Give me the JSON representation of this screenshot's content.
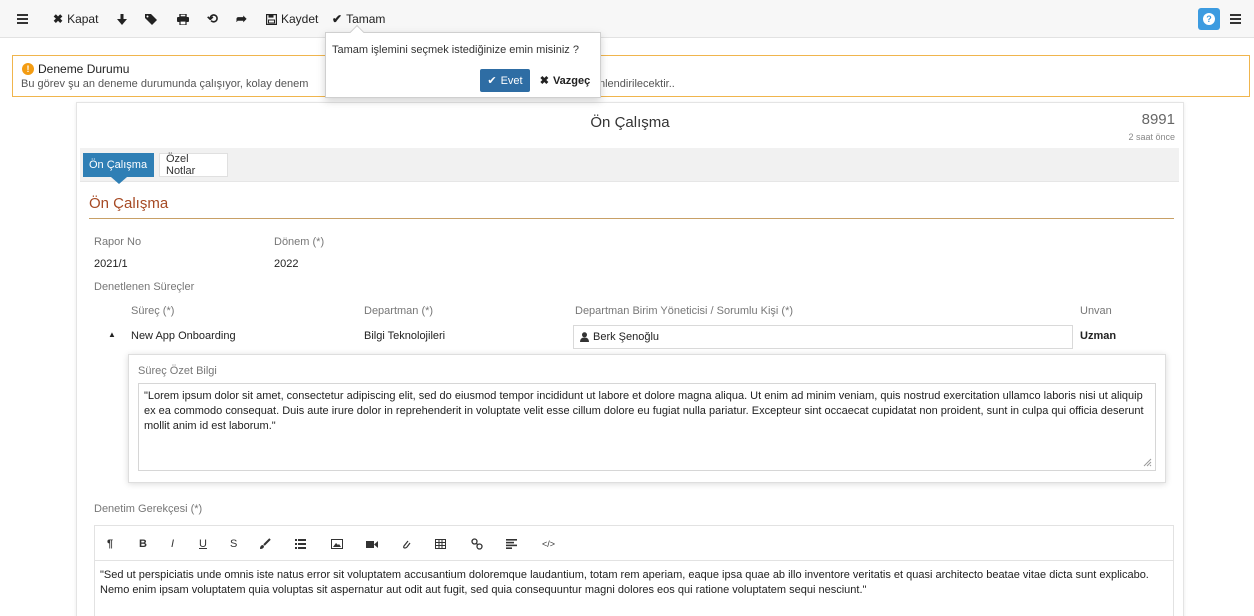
{
  "toolbar": {
    "menu_icon": "hamburger-icon",
    "close_label": "Kapat",
    "save_label": "Kaydet",
    "done_label": "Tamam",
    "help_label": "?"
  },
  "alert": {
    "title": "Deneme Durumu",
    "text_left": "Bu görev şu an deneme durumunda çalışıyor, kolay denem",
    "text_right": "nlendirilecektir.."
  },
  "popover": {
    "question": "Tamam işlemini seçmek istediğinize emin misiniz ?",
    "yes_label": "Evet",
    "no_label": "Vazgeç"
  },
  "card": {
    "title": "Ön Çalışma",
    "number": "8991",
    "time": "2 saat önce",
    "tabs": [
      {
        "label": "Ön Çalışma",
        "active": true
      },
      {
        "label": "Özel Notlar",
        "active": false
      }
    ],
    "section_title": "Ön Çalışma",
    "rapor_no_label": "Rapor No",
    "rapor_no_value": "2021/1",
    "donem_label": "Dönem (*)",
    "donem_value": "2022",
    "denetlenen_label": "Denetlenen Süreçler",
    "columns": {
      "surec": "Süreç (*)",
      "departman": "Departman (*)",
      "yonetici": "Departman Birim Yöneticisi / Sorumlu Kişi (*)",
      "unvan": "Unvan"
    },
    "row": {
      "surec": "New App Onboarding",
      "departman": "Bilgi Teknolojileri",
      "yonetici": "Berk Şenoğlu",
      "unvan": "Uzman"
    },
    "summary_label": "Süreç Özet Bilgi",
    "summary_text": "\"Lorem ipsum dolor sit amet, consectetur adipiscing elit, sed do eiusmod tempor incididunt ut labore et dolore magna aliqua. Ut enim ad minim veniam, quis nostrud exercitation ullamco laboris nisi ut aliquip ex ea commodo consequat. Duis aute irure dolor in reprehenderit in voluptate velit esse cillum dolore eu fugiat nulla pariatur. Excepteur sint occaecat cupidatat non proident, sunt in culpa qui officia deserunt mollit anim id est laborum.\"",
    "gerekce_label": "Denetim Gerekçesi (*)",
    "editor_buttons": {
      "paragraph": "¶",
      "bold": "B",
      "italic": "I",
      "underline": "U",
      "strike": "S"
    },
    "editor_text": "\"Sed ut perspiciatis unde omnis iste natus error sit voluptatem accusantium doloremque laudantium, totam rem aperiam, eaque ipsa quae ab illo inventore veritatis et quasi architecto beatae vitae dicta sunt explicabo. Nemo enim ipsam voluptatem quia voluptas sit aspernatur aut odit aut fugit, sed quia consequuntur magni dolores eos qui ratione voluptatem sequi nesciunt.\""
  },
  "colors": {
    "accent_blue": "#2f7fb5",
    "section_title": "#a64a24",
    "alert_border": "#f0b54d",
    "help_button": "#3c9be0"
  }
}
